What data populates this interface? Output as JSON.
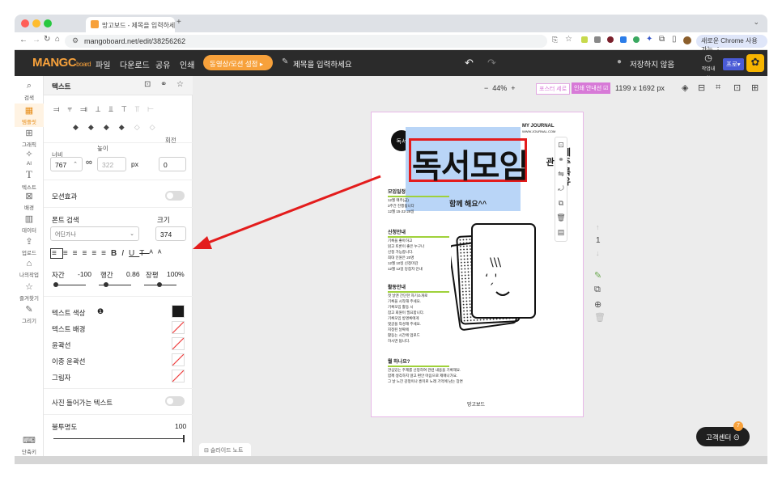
{
  "browser": {
    "tab_title": "망고보드 - 제목을 입력하세요",
    "url": "mangoboard.net/edit/38256262",
    "update_label": "새로운 Chrome 사용 가능"
  },
  "app": {
    "logo": "MANGC",
    "logo_suffix": "board",
    "menu": [
      "파일",
      "다운로드",
      "공유",
      "인쇄"
    ],
    "video_button": "동영상/모션 설정 ▸",
    "title_placeholder": "제목을 입력하세요",
    "save_status": "저장하지 않음",
    "history_label": "작업내역",
    "pro_badge": "프로▾"
  },
  "rail": [
    "검색",
    "템플릿",
    "그래픽",
    "AI",
    "텍스트",
    "배경",
    "데이터",
    "업로드",
    "나의작업",
    "즐겨찾기",
    "그리기",
    "단축키"
  ],
  "panel": {
    "header": "텍스트",
    "width_label": "너비",
    "height_label": "높이",
    "rotate_label": "회전",
    "width_value": "767",
    "height_value": "322",
    "unit": "px",
    "rotate_value": "0",
    "motion_label": "모션효과",
    "font_search_label": "폰트 검색",
    "size_label": "크기",
    "font_value": "어딘가나",
    "size_value": "374",
    "spacing_labels": [
      "자간",
      "행간",
      "장평"
    ],
    "spacing_values": [
      "-100",
      "0.86",
      "100%"
    ],
    "text_color": "텍스트 색상",
    "text_bg": "텍스트 배경",
    "outline": "윤곽선",
    "double_outline": "이중 윤곽선",
    "shadow": "그림자",
    "photo_text": "사진 들어가는 텍스트",
    "opacity_label": "불투명도",
    "opacity_value": "100"
  },
  "canvas": {
    "zoom": "44%",
    "safe_label": "포스터 세로",
    "print_label": "인쇄 안내선",
    "size_readout": "1199 x 1692 px",
    "page_num": "1",
    "slide_note": "슬라이드 노트",
    "help_button": "고객센터",
    "help_badge": "7"
  },
  "doc": {
    "heading": "독서모임",
    "journal": "MY JOURNAL",
    "journal_url": "WWW.JOURNAL.COM",
    "side_text": [
      "함께",
      "관심주",
      "기록",
      "공유"
    ],
    "sub": "함께 해요^^",
    "badge": "독서",
    "sections": [
      {
        "title": "모임일정",
        "lines": [
          "12월 매주(금)",
          "3주간 진행됩니다",
          "12월 15·22·29일"
        ]
      },
      {
        "title": "신청안내",
        "lines": [
          "기록을 좋아하고",
          "읽고 토론이 좋은 누구나",
          "신청 가능합니다.",
          "최대 인원은 20명",
          "12월 10일 신청마감",
          "12월 12일 당첨자 안내"
        ]
      },
      {
        "title": "활동안내",
        "lines": [
          "첫 날엔 간단한 자기소개로",
          "기록을 시작해 주세요.",
          "기록모임 활동 시",
          "참고 회원이 필요합니다.",
          "기록모임 방명록에게",
          "댓글을 작성해 주세요.",
          "지정된 날짜에",
          "활동는 시간에 업로드",
          "하시면 됩니다."
        ]
      },
      {
        "title": "뭘 하나요?",
        "lines": [
          "관심있는 주제를 선정하여 관련 내용을 기록해요.",
          "함께 생각하지 않고 편안 마음으로 제매나가요.",
          "그 날 느낀 감정이나 흥미로 노래 기억에 남는 장면"
        ]
      }
    ],
    "footer": "망고보드"
  },
  "colors": {
    "accent": "#f7a13b",
    "highlight": "#e31c1c",
    "selection": "#b9d5f7"
  }
}
